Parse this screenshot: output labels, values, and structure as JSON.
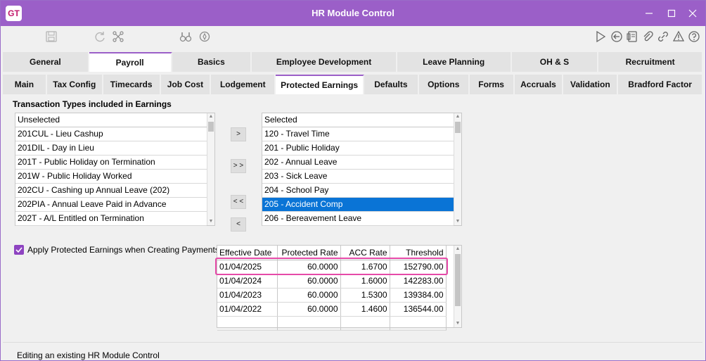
{
  "window": {
    "logo": "GT",
    "title": "HR Module Control",
    "accent": "#9b5fc8"
  },
  "toolbar": {
    "left_icons": [
      "save-icon",
      "refresh-icon",
      "tree-icon",
      "binoculars-icon",
      "compass-icon"
    ],
    "right_icons": [
      "play-icon",
      "back-circle-icon",
      "document-icon",
      "paperclip-icon",
      "link-icon",
      "alert-icon",
      "help-icon"
    ]
  },
  "main_tabs": [
    {
      "label": "General"
    },
    {
      "label": "Payroll"
    },
    {
      "label": "Basics"
    },
    {
      "label": "Employee Development"
    },
    {
      "label": "Leave Planning"
    },
    {
      "label": "OH & S"
    },
    {
      "label": "Recruitment"
    }
  ],
  "sub_tabs": [
    {
      "label": "Main"
    },
    {
      "label": "Tax Config"
    },
    {
      "label": "Timecards"
    },
    {
      "label": "Job Cost"
    },
    {
      "label": "Lodgement"
    },
    {
      "label": "Protected Earnings"
    },
    {
      "label": "Defaults"
    },
    {
      "label": "Options"
    },
    {
      "label": "Forms"
    },
    {
      "label": "Accruals"
    },
    {
      "label": "Validation"
    },
    {
      "label": "Bradford Factor"
    }
  ],
  "section_title": "Transaction Types included in Earnings",
  "unselected": {
    "header": "Unselected",
    "items": [
      "201CUL - Lieu Cashup",
      "201DIL - Day in Lieu",
      "201T - Public Holiday on Termination",
      "201W - Public Holiday Worked",
      "202CU - Cashing up Annual Leave (202)",
      "202PIA - Annual Leave Paid in Advance",
      "202T - A/L Entitled on Termination"
    ]
  },
  "selected": {
    "header": "Selected",
    "items": [
      "120 - Travel Time",
      "201 - Public Holiday",
      "202 - Annual Leave",
      "203 - Sick Leave",
      "204 - School Pay",
      "205 - Accident Comp",
      "206 - Bereavement Leave"
    ],
    "selected_item": "205 - Accident Comp"
  },
  "move_buttons": {
    "add": ">",
    "add_all": "> >",
    "remove_all": "< <",
    "remove": "<"
  },
  "apply_checkbox": {
    "label": "Apply Protected Earnings when Creating Payments",
    "checked": true
  },
  "rates_grid": {
    "columns": [
      "Effective Date",
      "Protected Rate",
      "ACC Rate",
      "Threshold"
    ],
    "rows": [
      [
        "01/04/2025",
        "60.0000",
        "1.6700",
        "152790.00"
      ],
      [
        "01/04/2024",
        "60.0000",
        "1.6000",
        "142283.00"
      ],
      [
        "01/04/2023",
        "60.0000",
        "1.5300",
        "139384.00"
      ],
      [
        "01/04/2022",
        "60.0000",
        "1.4600",
        "136544.00"
      ]
    ],
    "highlight_color": "#e64aa8"
  },
  "status_bar": "Editing an existing HR Module Control"
}
